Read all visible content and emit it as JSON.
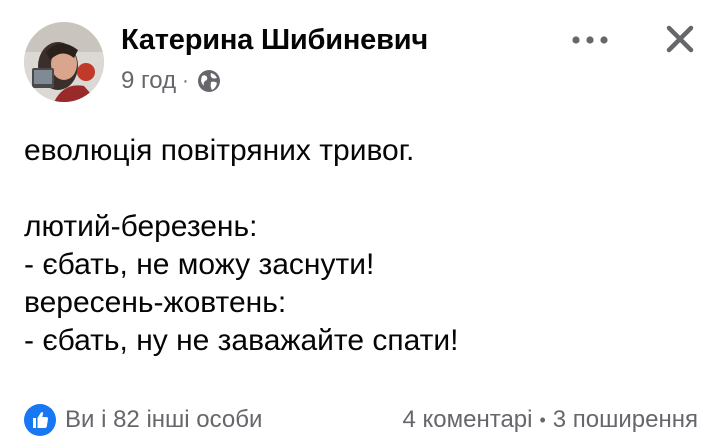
{
  "author": {
    "name": "Катерина Шибиневич"
  },
  "meta": {
    "time": "9 год",
    "separator": "·",
    "audience_icon": "globe-icon"
  },
  "header": {
    "more_icon": "more-options-icon",
    "close_icon": "close-icon"
  },
  "post": {
    "lines": [
      "еволюція повітряних тривог.",
      "",
      "лютий-березень:",
      "- єбать, не можу заснути!",
      "вересень-жовтень:",
      "- єбать, ну не заважайте спати!"
    ]
  },
  "footer": {
    "reaction_icon": "like-icon",
    "reactions_text": "Ви і 82 інші особи",
    "comments": "4 коментарі",
    "separator": "•",
    "shares": "3 поширення"
  },
  "colors": {
    "text_primary": "#050505",
    "text_secondary": "#65676b",
    "like_blue": "#1877f2"
  }
}
